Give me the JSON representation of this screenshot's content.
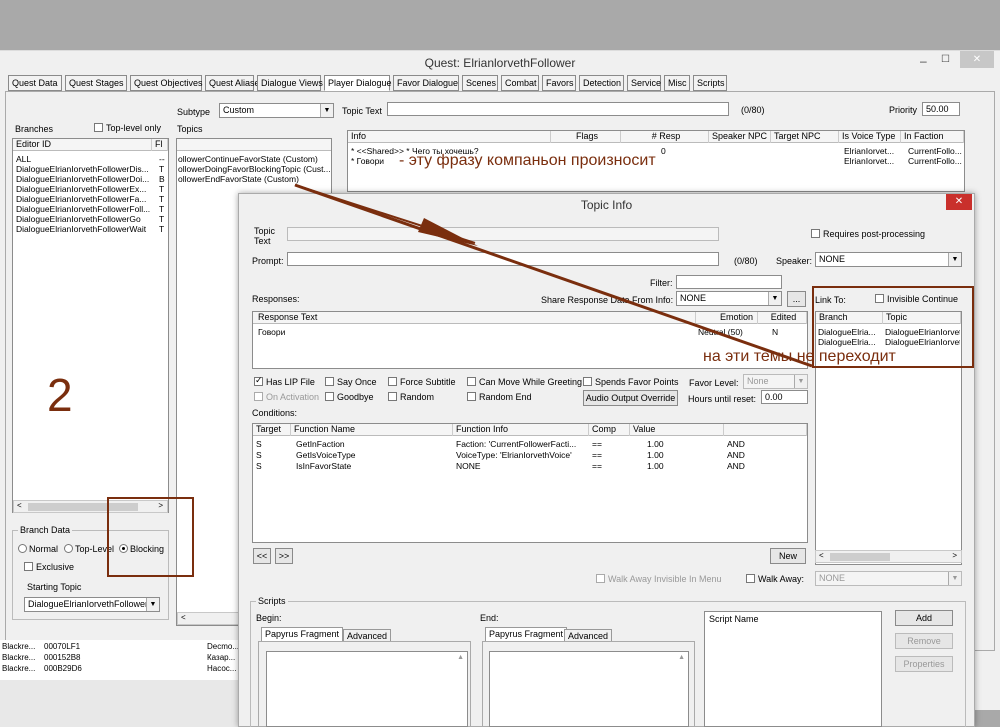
{
  "quest_window": {
    "title": "Quest: ElrianlorvethFollower",
    "controls": {
      "minimize": "–",
      "maximize": "☐",
      "close": "✕"
    },
    "tabs": [
      "Quest Data",
      "Quest Stages",
      "Quest Objectives",
      "Quest Aliases",
      "Dialogue Views",
      "Player Dialogue",
      "Favor Dialogue",
      "Scenes",
      "Combat",
      "Favors",
      "Detection",
      "Service",
      "Misc",
      "Scripts"
    ],
    "active_tab": "Player Dialogue",
    "subtype_label": "Subtype",
    "subtype_value": "Custom",
    "topic_text_label": "Topic Text",
    "topic_text_count": "(0/80)",
    "priority_label": "Priority",
    "priority_value": "50.00",
    "branches_label": "Branches",
    "top_level_only": "Top-level only",
    "topics_label": "Topics",
    "branches_columns": [
      "Editor ID",
      "Fl"
    ],
    "branches": [
      {
        "id": "ALL",
        "fl": "--"
      },
      {
        "id": "DialogueElrianIorvethFollowerDis...",
        "fl": "T"
      },
      {
        "id": "DialogueElrianIorvethFollowerDoi...",
        "fl": "B"
      },
      {
        "id": "DialogueElrianIorvethFollowerEx...",
        "fl": "T"
      },
      {
        "id": "DialogueElrianIorvethFollowerFa...",
        "fl": "T"
      },
      {
        "id": "DialogueElrianIorvethFollowerFoll...",
        "fl": "T"
      },
      {
        "id": "DialogueElrianIorvethFollowerGo",
        "fl": "T"
      },
      {
        "id": "DialogueElrianIorvethFollowerWait",
        "fl": "T"
      }
    ],
    "topics": [
      "ollowerContinueFavorState (Custom)",
      "ollowerDoingFavorBlockingTopic (Cust...",
      "ollowerEndFavorState (Custom)"
    ],
    "info_columns": [
      "Info",
      "Flags",
      "# Resp",
      "Speaker NPC",
      "Target NPC",
      "Is Voice Type",
      "In Faction"
    ],
    "info_rows": [
      {
        "info": "* <<Shared>> * Чего ты хочешь?",
        "resp": "0",
        "voice": "ElrianIorvet...",
        "faction": "CurrentFollo..."
      },
      {
        "info": "* Говори",
        "resp": "",
        "voice": "ElrianIorvet...",
        "faction": "CurrentFollo..."
      }
    ],
    "branch_data_label": "Branch Data",
    "branch_types": [
      "Normal",
      "Top-Level",
      "Blocking"
    ],
    "exclusive_label": "Exclusive",
    "starting_topic_label": "Starting Topic",
    "starting_topic_value": "DialogueElrianIorvethFollowerD",
    "bottom_rows": [
      {
        "a": "Blackre...",
        "b": "00070LF1",
        "c": "Decmo..."
      },
      {
        "a": "Blackre...",
        "b": "000152B8",
        "c": "Казар..."
      },
      {
        "a": "Blackre...",
        "b": "000B29D6",
        "c": "Насос..."
      }
    ]
  },
  "topic_info": {
    "title": "Topic Info",
    "close": "✕",
    "topic_text_label": "Topic\nText",
    "requires_post": "Requires post-processing",
    "prompt_label": "Prompt:",
    "prompt_count": "(0/80)",
    "speaker_label": "Speaker:",
    "speaker_value": "NONE",
    "filter_label": "Filter:",
    "responses_label": "Responses:",
    "share_label": "Share Response Data From Info:",
    "share_value": "NONE",
    "ellipsis": "...",
    "response_columns": [
      "Response Text",
      "Emotion",
      "Edited"
    ],
    "responses": [
      {
        "text": "Говори",
        "emotion": "Neutral (50)",
        "edited": "N"
      }
    ],
    "link_to_label": "Link To:",
    "invisible_continue": "Invisible Continue",
    "link_columns": [
      "Branch",
      "Topic"
    ],
    "links": [
      {
        "branch": "DialogueElria...",
        "topic": "DialogueElrianIorvet"
      },
      {
        "branch": "DialogueElria...",
        "topic": "DialogueElrianIorvet"
      }
    ],
    "flags_row1": [
      "Has LIP File",
      "Say Once",
      "Force Subtitle",
      "Can Move While Greeting",
      "Spends Favor Points"
    ],
    "favor_level_label": "Favor Level:",
    "favor_level_value": "None",
    "flags_row2": [
      "On Activation",
      "Goodbye",
      "Random",
      "Random End"
    ],
    "audio_override": "Audio Output Override",
    "hours_label": "Hours until reset:",
    "hours_value": "0.00",
    "conditions_label": "Conditions:",
    "condition_columns": [
      "Target",
      "Function Name",
      "Function Info",
      "Comp",
      "Value",
      ""
    ],
    "conditions": [
      {
        "target": "S",
        "func": "GetInFaction",
        "info": "Faction: 'CurrentFollowerFacti...",
        "comp": "==",
        "value": "1.00",
        "op": "AND"
      },
      {
        "target": "S",
        "func": "GetIsVoiceType",
        "info": "VoiceType: 'ElrianIorvethVoice'",
        "comp": "==",
        "value": "1.00",
        "op": "AND"
      },
      {
        "target": "S",
        "func": "IsInFavorState",
        "info": "NONE",
        "comp": "==",
        "value": "1.00",
        "op": "AND"
      }
    ],
    "prev_btn": "<<",
    "next_btn": ">>",
    "new_btn": "New",
    "walk_away_invisible": "Walk Away Invisible In Menu",
    "walk_away": "Walk Away:",
    "walk_away_value": "NONE",
    "scripts_label": "Scripts",
    "begin_label": "Begin:",
    "end_label": "End:",
    "papyrus_tab": "Papyrus Fragment",
    "advanced_tab": "Advanced",
    "script_name_col": "Script Name",
    "add_btn": "Add",
    "remove_btn": "Remove",
    "properties_btn": "Properties"
  },
  "annotations": {
    "phrase_note": "- эту фразу компаньон произносит",
    "topics_note": "на эти темы не переходит",
    "number": "2",
    "color": "#7a2e0e"
  }
}
